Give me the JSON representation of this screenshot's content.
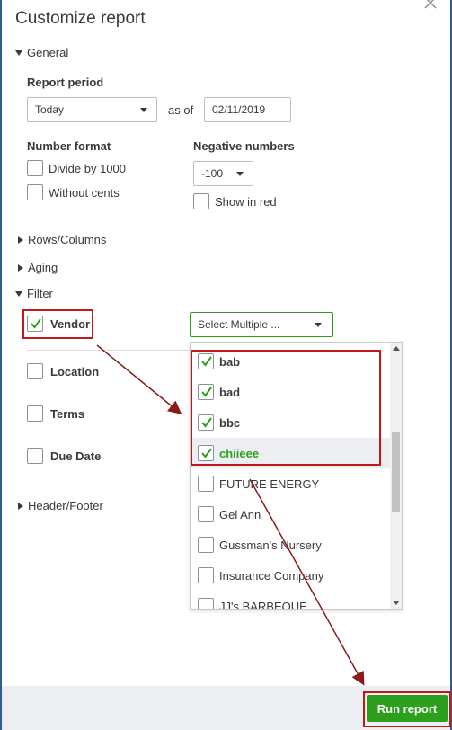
{
  "dialog": {
    "title": "Customize report"
  },
  "sections": {
    "general": "General",
    "rows_columns": "Rows/Columns",
    "aging": "Aging",
    "filter": "Filter",
    "header_footer": "Header/Footer"
  },
  "general": {
    "report_period_label": "Report period",
    "report_period_value": "Today",
    "as_of_label": "as of",
    "as_of_date": "02/11/2019",
    "number_format_label": "Number format",
    "divide_by_1000": "Divide by 1000",
    "without_cents": "Without cents",
    "negative_numbers_label": "Negative numbers",
    "negative_numbers_value": "-100",
    "show_in_red": "Show in red"
  },
  "filter": {
    "vendor": {
      "label": "Vendor",
      "checked": true
    },
    "location": {
      "label": "Location",
      "checked": false
    },
    "terms": {
      "label": "Terms",
      "checked": false
    },
    "due_date": {
      "label": "Due Date",
      "checked": false
    },
    "vendor_select_placeholder": "Select Multiple ...",
    "vendor_options": [
      {
        "label": "bab",
        "checked": true
      },
      {
        "label": "bad",
        "checked": true
      },
      {
        "label": "bbc",
        "checked": true
      },
      {
        "label": "chiieee",
        "checked": true
      },
      {
        "label": "FUTURE ENERGY",
        "checked": false
      },
      {
        "label": "Gel Ann",
        "checked": false
      },
      {
        "label": "Gussman's Nursery",
        "checked": false
      },
      {
        "label": "Insurance Company",
        "checked": false
      },
      {
        "label": "JJ's BARBEQUE",
        "checked": false
      }
    ]
  },
  "footer": {
    "run_report": "Run report"
  },
  "colors": {
    "accent_green": "#2ca01c",
    "annotation_red": "#c0181d",
    "frame_blue": "#2f5d94"
  }
}
